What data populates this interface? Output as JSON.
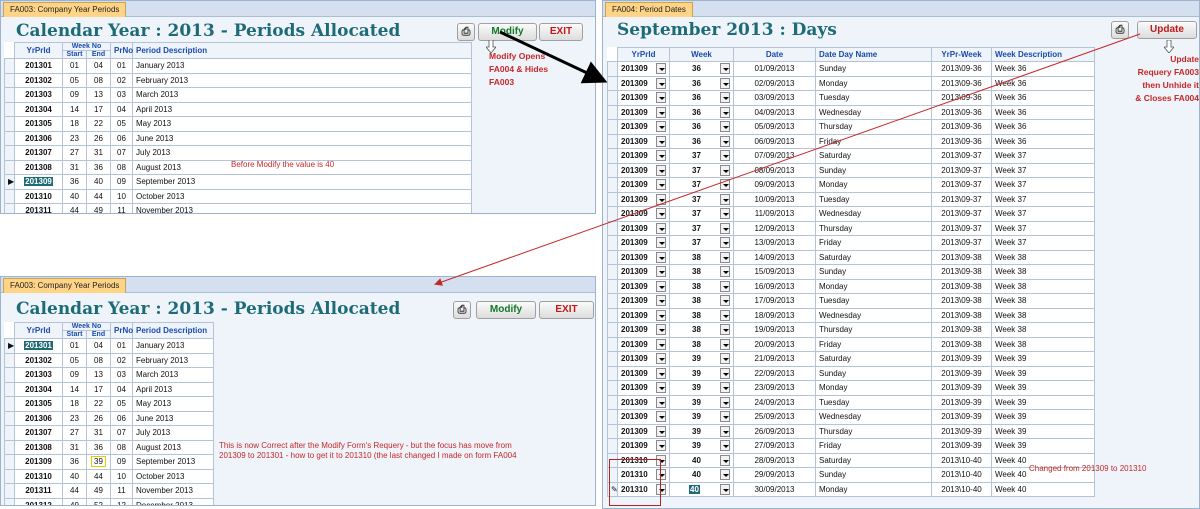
{
  "top_form": {
    "tab_label": "FA003: Company Year Periods",
    "title": "Calendar Year : 2013 - Periods Allocated",
    "print_icon": "printer-icon",
    "modify_label": "Modify",
    "exit_label": "EXIT",
    "columns": {
      "yrprid": "YrPrId",
      "week_no": "Week No",
      "start": "Start",
      "end": "End",
      "prno": "PrNo",
      "desc": "Period Description"
    },
    "rows": [
      {
        "yrprid": "201301",
        "start": "01",
        "end": "04",
        "prno": "01",
        "desc": "January 2013"
      },
      {
        "yrprid": "201302",
        "start": "05",
        "end": "08",
        "prno": "02",
        "desc": "February 2013"
      },
      {
        "yrprid": "201303",
        "start": "09",
        "end": "13",
        "prno": "03",
        "desc": "March 2013"
      },
      {
        "yrprid": "201304",
        "start": "14",
        "end": "17",
        "prno": "04",
        "desc": "April 2013"
      },
      {
        "yrprid": "201305",
        "start": "18",
        "end": "22",
        "prno": "05",
        "desc": "May 2013"
      },
      {
        "yrprid": "201306",
        "start": "23",
        "end": "26",
        "prno": "06",
        "desc": "June 2013"
      },
      {
        "yrprid": "201307",
        "start": "27",
        "end": "31",
        "prno": "07",
        "desc": "July 2013"
      },
      {
        "yrprid": "201308",
        "start": "31",
        "end": "36",
        "prno": "08",
        "desc": "August 2013"
      },
      {
        "yrprid": "201309",
        "start": "36",
        "end": "40",
        "prno": "09",
        "desc": "September 2013"
      },
      {
        "yrprid": "201310",
        "start": "40",
        "end": "44",
        "prno": "10",
        "desc": "October 2013"
      },
      {
        "yrprid": "201311",
        "start": "44",
        "end": "49",
        "prno": "11",
        "desc": "November 2013"
      },
      {
        "yrprid": "201312",
        "start": "49",
        "end": "52",
        "prno": "12",
        "desc": "December 2013"
      }
    ],
    "note_before": "Before Modify the value is 40",
    "note_modify": "Modify Opens\nFA004 & Hides\nFA003"
  },
  "bottom_form": {
    "tab_label": "FA003: Company Year Periods",
    "title": "Calendar Year : 2013 - Periods Allocated",
    "print_icon": "printer-icon",
    "modify_label": "Modify",
    "exit_label": "EXIT",
    "columns": {
      "yrprid": "YrPrId",
      "week_no": "Week No",
      "start": "Start",
      "end": "End",
      "prno": "PrNo",
      "desc": "Period Description"
    },
    "rows": [
      {
        "yrprid": "201301",
        "start": "01",
        "end": "04",
        "prno": "01",
        "desc": "January 2013"
      },
      {
        "yrprid": "201302",
        "start": "05",
        "end": "08",
        "prno": "02",
        "desc": "February 2013"
      },
      {
        "yrprid": "201303",
        "start": "09",
        "end": "13",
        "prno": "03",
        "desc": "March 2013"
      },
      {
        "yrprid": "201304",
        "start": "14",
        "end": "17",
        "prno": "04",
        "desc": "April 2013"
      },
      {
        "yrprid": "201305",
        "start": "18",
        "end": "22",
        "prno": "05",
        "desc": "May 2013"
      },
      {
        "yrprid": "201306",
        "start": "23",
        "end": "26",
        "prno": "06",
        "desc": "June 2013"
      },
      {
        "yrprid": "201307",
        "start": "27",
        "end": "31",
        "prno": "07",
        "desc": "July 2013"
      },
      {
        "yrprid": "201308",
        "start": "31",
        "end": "36",
        "prno": "08",
        "desc": "August 2013"
      },
      {
        "yrprid": "201309",
        "start": "36",
        "end": "39",
        "prno": "09",
        "desc": "September 2013"
      },
      {
        "yrprid": "201310",
        "start": "40",
        "end": "44",
        "prno": "10",
        "desc": "October 2013"
      },
      {
        "yrprid": "201311",
        "start": "44",
        "end": "49",
        "prno": "11",
        "desc": "November 2013"
      },
      {
        "yrprid": "201312",
        "start": "49",
        "end": "52",
        "prno": "12",
        "desc": "December 2013"
      }
    ],
    "note_line1": "This is now Correct after the Modify Form's Requery - but the focus has move from",
    "note_line2": "201309 to 201301 - how to get it to 201310 (the last changed I made on form FA004"
  },
  "right_form": {
    "tab_label": "FA004: Period Dates",
    "title": "September 2013 : Days",
    "print_icon": "printer-icon",
    "update_label": "Update",
    "columns": {
      "yrprid": "YrPrId",
      "week": "Week",
      "date": "Date",
      "dayname": "Date Day Name",
      "yrprweek": "YrPr-Week",
      "weekdesc": "Week Description"
    },
    "rows": [
      {
        "yrprid": "201309",
        "week": "36",
        "date": "01/09/2013",
        "day": "Sunday",
        "yrprweek": "2013\\09-36",
        "weekdesc": "Week 36"
      },
      {
        "yrprid": "201309",
        "week": "36",
        "date": "02/09/2013",
        "day": "Monday",
        "yrprweek": "2013\\09-36",
        "weekdesc": "Week 36"
      },
      {
        "yrprid": "201309",
        "week": "36",
        "date": "03/09/2013",
        "day": "Tuesday",
        "yrprweek": "2013\\09-36",
        "weekdesc": "Week 36"
      },
      {
        "yrprid": "201309",
        "week": "36",
        "date": "04/09/2013",
        "day": "Wednesday",
        "yrprweek": "2013\\09-36",
        "weekdesc": "Week 36"
      },
      {
        "yrprid": "201309",
        "week": "36",
        "date": "05/09/2013",
        "day": "Thursday",
        "yrprweek": "2013\\09-36",
        "weekdesc": "Week 36"
      },
      {
        "yrprid": "201309",
        "week": "36",
        "date": "06/09/2013",
        "day": "Friday",
        "yrprweek": "2013\\09-36",
        "weekdesc": "Week 36"
      },
      {
        "yrprid": "201309",
        "week": "37",
        "date": "07/09/2013",
        "day": "Saturday",
        "yrprweek": "2013\\09-37",
        "weekdesc": "Week 37"
      },
      {
        "yrprid": "201309",
        "week": "37",
        "date": "08/09/2013",
        "day": "Sunday",
        "yrprweek": "2013\\09-37",
        "weekdesc": "Week 37"
      },
      {
        "yrprid": "201309",
        "week": "37",
        "date": "09/09/2013",
        "day": "Monday",
        "yrprweek": "2013\\09-37",
        "weekdesc": "Week 37"
      },
      {
        "yrprid": "201309",
        "week": "37",
        "date": "10/09/2013",
        "day": "Tuesday",
        "yrprweek": "2013\\09-37",
        "weekdesc": "Week 37"
      },
      {
        "yrprid": "201309",
        "week": "37",
        "date": "11/09/2013",
        "day": "Wednesday",
        "yrprweek": "2013\\09-37",
        "weekdesc": "Week 37"
      },
      {
        "yrprid": "201309",
        "week": "37",
        "date": "12/09/2013",
        "day": "Thursday",
        "yrprweek": "2013\\09-37",
        "weekdesc": "Week 37"
      },
      {
        "yrprid": "201309",
        "week": "37",
        "date": "13/09/2013",
        "day": "Friday",
        "yrprweek": "2013\\09-37",
        "weekdesc": "Week 37"
      },
      {
        "yrprid": "201309",
        "week": "38",
        "date": "14/09/2013",
        "day": "Saturday",
        "yrprweek": "2013\\09-38",
        "weekdesc": "Week 38"
      },
      {
        "yrprid": "201309",
        "week": "38",
        "date": "15/09/2013",
        "day": "Sunday",
        "yrprweek": "2013\\09-38",
        "weekdesc": "Week 38"
      },
      {
        "yrprid": "201309",
        "week": "38",
        "date": "16/09/2013",
        "day": "Monday",
        "yrprweek": "2013\\09-38",
        "weekdesc": "Week 38"
      },
      {
        "yrprid": "201309",
        "week": "38",
        "date": "17/09/2013",
        "day": "Tuesday",
        "yrprweek": "2013\\09-38",
        "weekdesc": "Week 38"
      },
      {
        "yrprid": "201309",
        "week": "38",
        "date": "18/09/2013",
        "day": "Wednesday",
        "yrprweek": "2013\\09-38",
        "weekdesc": "Week 38"
      },
      {
        "yrprid": "201309",
        "week": "38",
        "date": "19/09/2013",
        "day": "Thursday",
        "yrprweek": "2013\\09-38",
        "weekdesc": "Week 38"
      },
      {
        "yrprid": "201309",
        "week": "38",
        "date": "20/09/2013",
        "day": "Friday",
        "yrprweek": "2013\\09-38",
        "weekdesc": "Week 38"
      },
      {
        "yrprid": "201309",
        "week": "39",
        "date": "21/09/2013",
        "day": "Saturday",
        "yrprweek": "2013\\09-39",
        "weekdesc": "Week 39"
      },
      {
        "yrprid": "201309",
        "week": "39",
        "date": "22/09/2013",
        "day": "Sunday",
        "yrprweek": "2013\\09-39",
        "weekdesc": "Week 39"
      },
      {
        "yrprid": "201309",
        "week": "39",
        "date": "23/09/2013",
        "day": "Monday",
        "yrprweek": "2013\\09-39",
        "weekdesc": "Week 39"
      },
      {
        "yrprid": "201309",
        "week": "39",
        "date": "24/09/2013",
        "day": "Tuesday",
        "yrprweek": "2013\\09-39",
        "weekdesc": "Week 39"
      },
      {
        "yrprid": "201309",
        "week": "39",
        "date": "25/09/2013",
        "day": "Wednesday",
        "yrprweek": "2013\\09-39",
        "weekdesc": "Week 39"
      },
      {
        "yrprid": "201309",
        "week": "39",
        "date": "26/09/2013",
        "day": "Thursday",
        "yrprweek": "2013\\09-39",
        "weekdesc": "Week 39"
      },
      {
        "yrprid": "201309",
        "week": "39",
        "date": "27/09/2013",
        "day": "Friday",
        "yrprweek": "2013\\09-39",
        "weekdesc": "Week 39"
      },
      {
        "yrprid": "201310",
        "week": "40",
        "date": "28/09/2013",
        "day": "Saturday",
        "yrprweek": "2013\\10-40",
        "weekdesc": "Week 40"
      },
      {
        "yrprid": "201310",
        "week": "40",
        "date": "29/09/2013",
        "day": "Sunday",
        "yrprweek": "2013\\10-40",
        "weekdesc": "Week 40"
      },
      {
        "yrprid": "201310",
        "week": "40",
        "date": "30/09/2013",
        "day": "Monday",
        "yrprweek": "2013\\10-40",
        "weekdesc": "Week 40"
      }
    ],
    "note_update": "Update\nRequery FA003\nthen Unhide it\n& Closes FA004",
    "note_changed": "Changed from 201309 to 201310"
  },
  "colors": {
    "accent_teal": "#1e6b77",
    "annotation_red": "#c62828",
    "modify_green": "#0f7a27",
    "tab_orange": "#ffd486"
  }
}
